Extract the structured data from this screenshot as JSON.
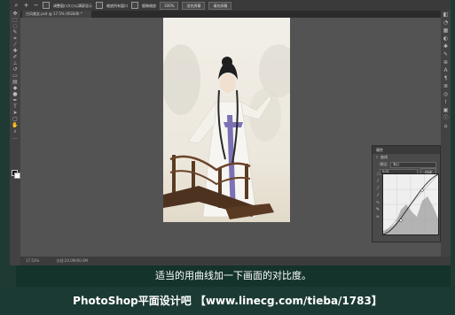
{
  "options_bar": {
    "checkbox1_label": "调整窗口大小以满屏显示",
    "checkbox2_label": "缩放所有窗口",
    "checkbox3_label": "细微缩放",
    "zoom_value": "100%",
    "fit_screen_label": "适合屏幕",
    "fill_screen_label": "填充屏幕"
  },
  "document": {
    "tab_title": "古风美女.psd @ 17.5% (RGB/8) *",
    "status_zoom": "17.53%",
    "status_doc": "文档:20.0M/60.0M"
  },
  "panel": {
    "title": "属性",
    "header": "曲线",
    "preset_label": "预设:",
    "preset_value": "默认",
    "channel_value": "RGB",
    "auto_label": "自动"
  },
  "caption": {
    "text": "适当的用曲线加一下画面的对比度。"
  },
  "watermark": {
    "text": "PhotoShop平面设计吧 【www.linecg.com/tieba/1783】"
  },
  "colors": {
    "ps_bg": "#535353",
    "caption_bg": "#14332b",
    "frame_bg": "#1f3a33"
  }
}
